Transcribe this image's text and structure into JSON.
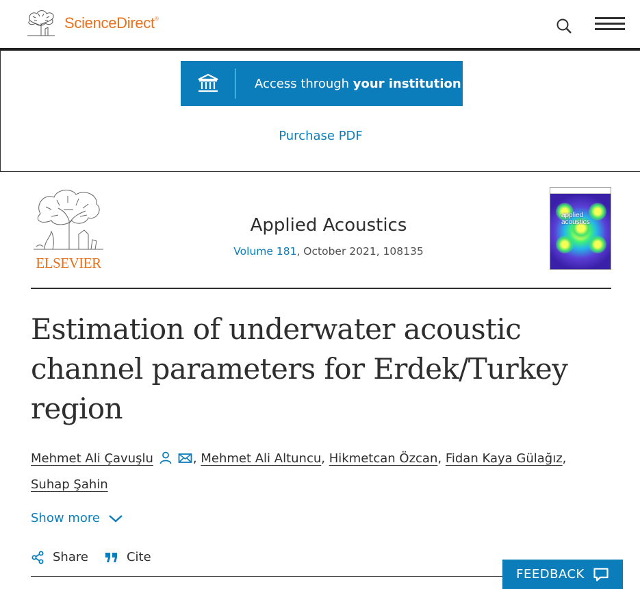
{
  "header": {
    "brand_name": "ScienceDirect",
    "brand_mark": "®",
    "search_icon": "search-icon",
    "menu_icon": "hamburger-menu-icon"
  },
  "access": {
    "label_prefix": "Access through ",
    "label_bold": "your institution",
    "icon": "institution-icon",
    "purchase_label": "Purchase PDF"
  },
  "journal": {
    "publisher": "ELSEVIER",
    "title": "Applied Acoustics",
    "volume": "Volume 181",
    "details": ", October 2021, 108135",
    "cover_text_1": "applied",
    "cover_text_2": "acoustics"
  },
  "article": {
    "title": "Estimation of underwater acoustic channel parameters for Erdek/Turkey region",
    "authors": [
      "Mehmet Ali Çavuşlu",
      "Mehmet Ali Altuncu",
      "Hikmetcan Özcan",
      "Fidan Kaya Gülağız",
      "Suhap Şahin"
    ],
    "sep": ", ",
    "trailing_comma": ","
  },
  "controls": {
    "show_more": "Show more",
    "share": "Share",
    "cite": "Cite",
    "feedback": "FEEDBACK"
  },
  "colors": {
    "accent": "#0c7dbb",
    "brand_orange": "#e9711c",
    "text": "#2e2e2e"
  }
}
